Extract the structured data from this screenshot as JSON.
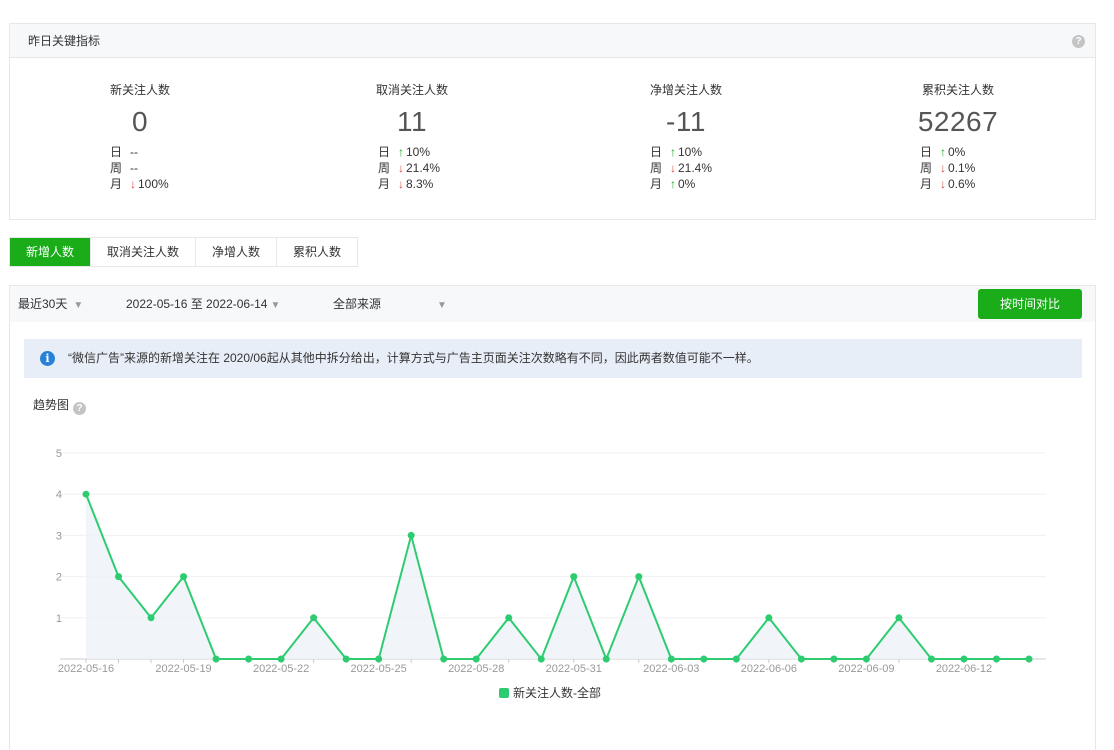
{
  "panel": {
    "title": "昨日关键指标",
    "help": "?"
  },
  "metrics": [
    {
      "title": "新关注人数",
      "value": "0",
      "rows": [
        {
          "label": "日",
          "dir": "",
          "text": "--"
        },
        {
          "label": "周",
          "dir": "",
          "text": "--"
        },
        {
          "label": "月",
          "dir": "down",
          "text": "100%"
        }
      ]
    },
    {
      "title": "取消关注人数",
      "value": "11",
      "rows": [
        {
          "label": "日",
          "dir": "up",
          "text": "10%"
        },
        {
          "label": "周",
          "dir": "down",
          "text": "21.4%"
        },
        {
          "label": "月",
          "dir": "down",
          "text": "8.3%"
        }
      ]
    },
    {
      "title": "净增关注人数",
      "value": "-11",
      "rows": [
        {
          "label": "日",
          "dir": "up",
          "text": "10%"
        },
        {
          "label": "周",
          "dir": "down",
          "text": "21.4%"
        },
        {
          "label": "月",
          "dir": "up",
          "text": "0%"
        }
      ]
    },
    {
      "title": "累积关注人数",
      "value": "52267",
      "rows": [
        {
          "label": "日",
          "dir": "up",
          "text": "0%"
        },
        {
          "label": "周",
          "dir": "down",
          "text": "0.1%"
        },
        {
          "label": "月",
          "dir": "down",
          "text": "0.6%"
        }
      ]
    }
  ],
  "tabs": [
    {
      "label": "新增人数",
      "active": true
    },
    {
      "label": "取消关注人数"
    },
    {
      "label": "净增人数"
    },
    {
      "label": "累积人数"
    }
  ],
  "filters": {
    "range": "最近30天",
    "dates": "2022-05-16 至 2022-06-14",
    "source": "全部来源",
    "compare_button": "按时间对比"
  },
  "notice": {
    "text": "“微信广告”来源的新增关注在 2020/06起从其他中拆分给出，计算方式与广告主页面关注次数略有不同，因此两者数值可能不一样。"
  },
  "trend": {
    "title": "趋势图",
    "help": "?"
  },
  "colors": {
    "accent": "#1aad19",
    "up": "#1aad19",
    "down": "#e64340",
    "line": "#2ecc71"
  },
  "chart_data": {
    "type": "line",
    "x": [
      "2022-05-16",
      "2022-05-17",
      "2022-05-18",
      "2022-05-19",
      "2022-05-20",
      "2022-05-21",
      "2022-05-22",
      "2022-05-23",
      "2022-05-24",
      "2022-05-25",
      "2022-05-26",
      "2022-05-27",
      "2022-05-28",
      "2022-05-29",
      "2022-05-30",
      "2022-05-31",
      "2022-06-01",
      "2022-06-02",
      "2022-06-03",
      "2022-06-04",
      "2022-06-05",
      "2022-06-06",
      "2022-06-07",
      "2022-06-08",
      "2022-06-09",
      "2022-06-10",
      "2022-06-11",
      "2022-06-12",
      "2022-06-13",
      "2022-06-14"
    ],
    "tick_labels": [
      "2022-05-16",
      "2022-05-19",
      "2022-05-22",
      "2022-05-25",
      "2022-05-28",
      "2022-05-31",
      "2022-06-03",
      "2022-06-06",
      "2022-06-09",
      "2022-06-12"
    ],
    "series": [
      {
        "name": "新关注人数-全部",
        "values": [
          4,
          2,
          1,
          2,
          0,
          0,
          0,
          1,
          0,
          0,
          3,
          0,
          0,
          1,
          0,
          2,
          0,
          2,
          0,
          0,
          0,
          1,
          0,
          0,
          0,
          1,
          0,
          0,
          0,
          0
        ]
      }
    ],
    "ylim": [
      0,
      5
    ],
    "yticks": [
      1,
      2,
      3,
      4,
      5
    ],
    "grid": true,
    "legend": "bottom-center"
  }
}
